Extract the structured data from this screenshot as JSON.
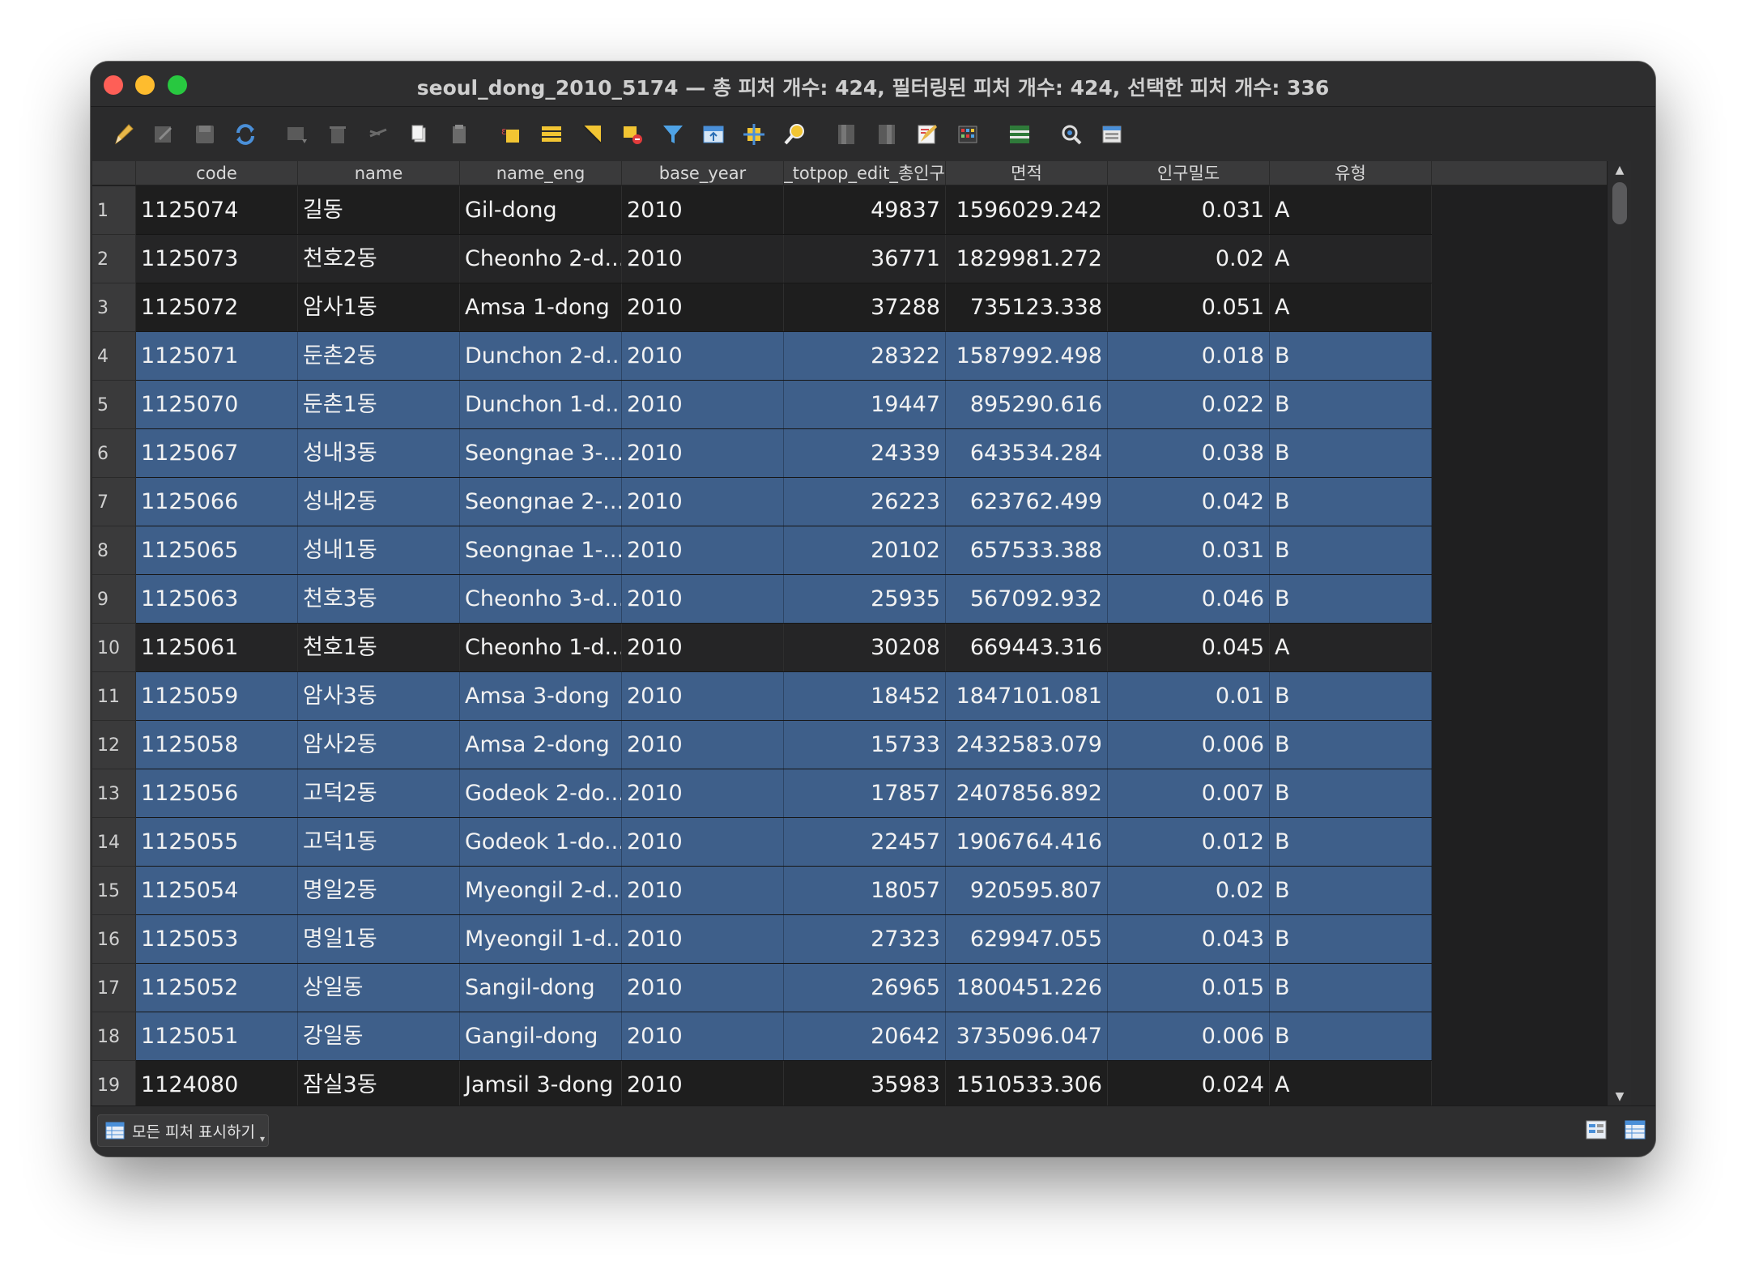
{
  "window": {
    "title": "seoul_dong_2010_5174 — 총 피처 개수: 424, 필터링된 피처 개수: 424, 선택한 피처 개수: 336"
  },
  "toolbar": {
    "icons": [
      "pencil-icon",
      "multi-edit-icon",
      "save-edits-icon",
      "reload-icon",
      "add-feature-icon",
      "delete-feature-icon",
      "cut-icon",
      "copy-icon",
      "paste-icon",
      "select-by-expression-icon",
      "select-all-icon",
      "invert-selection-icon",
      "deselect-all-icon",
      "filter-selection-icon",
      "move-selection-to-top-icon",
      "pan-to-selection-icon",
      "zoom-to-selection-icon",
      "new-field-icon",
      "delete-field-icon",
      "field-calculator-icon",
      "conditional-formatting-icon",
      "dock-table-icon",
      "actions-icon",
      "form-view-icon"
    ]
  },
  "table": {
    "columns": [
      "code",
      "name",
      "name_eng",
      "base_year",
      "_totpop_edit_총인구",
      "면적",
      "인구밀도",
      "유형"
    ],
    "rows": [
      {
        "n": "1",
        "code": "1125074",
        "name": "길동",
        "name_eng": "Gil-dong",
        "base_year": "2010",
        "pop": "49837",
        "area": "1596029.242",
        "density": "0.031",
        "type": "A",
        "selected": false
      },
      {
        "n": "2",
        "code": "1125073",
        "name": "천호2동",
        "name_eng": "Cheonho 2-d...",
        "base_year": "2010",
        "pop": "36771",
        "area": "1829981.272",
        "density": "0.02",
        "type": "A",
        "selected": false
      },
      {
        "n": "3",
        "code": "1125072",
        "name": "암사1동",
        "name_eng": "Amsa 1-dong",
        "base_year": "2010",
        "pop": "37288",
        "area": "735123.338",
        "density": "0.051",
        "type": "A",
        "selected": false
      },
      {
        "n": "4",
        "code": "1125071",
        "name": "둔촌2동",
        "name_eng": "Dunchon 2-d...",
        "base_year": "2010",
        "pop": "28322",
        "area": "1587992.498",
        "density": "0.018",
        "type": "B",
        "selected": true
      },
      {
        "n": "5",
        "code": "1125070",
        "name": "둔촌1동",
        "name_eng": "Dunchon 1-d...",
        "base_year": "2010",
        "pop": "19447",
        "area": "895290.616",
        "density": "0.022",
        "type": "B",
        "selected": true
      },
      {
        "n": "6",
        "code": "1125067",
        "name": "성내3동",
        "name_eng": "Seongnae 3-...",
        "base_year": "2010",
        "pop": "24339",
        "area": "643534.284",
        "density": "0.038",
        "type": "B",
        "selected": true
      },
      {
        "n": "7",
        "code": "1125066",
        "name": "성내2동",
        "name_eng": "Seongnae 2-...",
        "base_year": "2010",
        "pop": "26223",
        "area": "623762.499",
        "density": "0.042",
        "type": "B",
        "selected": true
      },
      {
        "n": "8",
        "code": "1125065",
        "name": "성내1동",
        "name_eng": "Seongnae 1-...",
        "base_year": "2010",
        "pop": "20102",
        "area": "657533.388",
        "density": "0.031",
        "type": "B",
        "selected": true
      },
      {
        "n": "9",
        "code": "1125063",
        "name": "천호3동",
        "name_eng": "Cheonho 3-d...",
        "base_year": "2010",
        "pop": "25935",
        "area": "567092.932",
        "density": "0.046",
        "type": "B",
        "selected": true
      },
      {
        "n": "10",
        "code": "1125061",
        "name": "천호1동",
        "name_eng": "Cheonho 1-d...",
        "base_year": "2010",
        "pop": "30208",
        "area": "669443.316",
        "density": "0.045",
        "type": "A",
        "selected": false
      },
      {
        "n": "11",
        "code": "1125059",
        "name": "암사3동",
        "name_eng": "Amsa 3-dong",
        "base_year": "2010",
        "pop": "18452",
        "area": "1847101.081",
        "density": "0.01",
        "type": "B",
        "selected": true
      },
      {
        "n": "12",
        "code": "1125058",
        "name": "암사2동",
        "name_eng": "Amsa 2-dong",
        "base_year": "2010",
        "pop": "15733",
        "area": "2432583.079",
        "density": "0.006",
        "type": "B",
        "selected": true
      },
      {
        "n": "13",
        "code": "1125056",
        "name": "고덕2동",
        "name_eng": "Godeok 2-do...",
        "base_year": "2010",
        "pop": "17857",
        "area": "2407856.892",
        "density": "0.007",
        "type": "B",
        "selected": true
      },
      {
        "n": "14",
        "code": "1125055",
        "name": "고덕1동",
        "name_eng": "Godeok 1-do...",
        "base_year": "2010",
        "pop": "22457",
        "area": "1906764.416",
        "density": "0.012",
        "type": "B",
        "selected": true
      },
      {
        "n": "15",
        "code": "1125054",
        "name": "명일2동",
        "name_eng": "Myeongil 2-d...",
        "base_year": "2010",
        "pop": "18057",
        "area": "920595.807",
        "density": "0.02",
        "type": "B",
        "selected": true
      },
      {
        "n": "16",
        "code": "1125053",
        "name": "명일1동",
        "name_eng": "Myeongil 1-d...",
        "base_year": "2010",
        "pop": "27323",
        "area": "629947.055",
        "density": "0.043",
        "type": "B",
        "selected": true
      },
      {
        "n": "17",
        "code": "1125052",
        "name": "상일동",
        "name_eng": "Sangil-dong",
        "base_year": "2010",
        "pop": "26965",
        "area": "1800451.226",
        "density": "0.015",
        "type": "B",
        "selected": true
      },
      {
        "n": "18",
        "code": "1125051",
        "name": "강일동",
        "name_eng": "Gangil-dong",
        "base_year": "2010",
        "pop": "20642",
        "area": "3735096.047",
        "density": "0.006",
        "type": "B",
        "selected": true
      },
      {
        "n": "19",
        "code": "1124080",
        "name": "잠실3동",
        "name_eng": "Jamsil 3-dong",
        "base_year": "2010",
        "pop": "35983",
        "area": "1510533.306",
        "density": "0.024",
        "type": "A",
        "selected": false
      }
    ]
  },
  "statusbar": {
    "filter_label": "모든 피처 표시하기",
    "icons": [
      "table-icon",
      "form-view-icon",
      "table-view-icon"
    ]
  },
  "colors": {
    "selected_row": "#3e5f8a",
    "window_bg": "#2b2b2c"
  }
}
